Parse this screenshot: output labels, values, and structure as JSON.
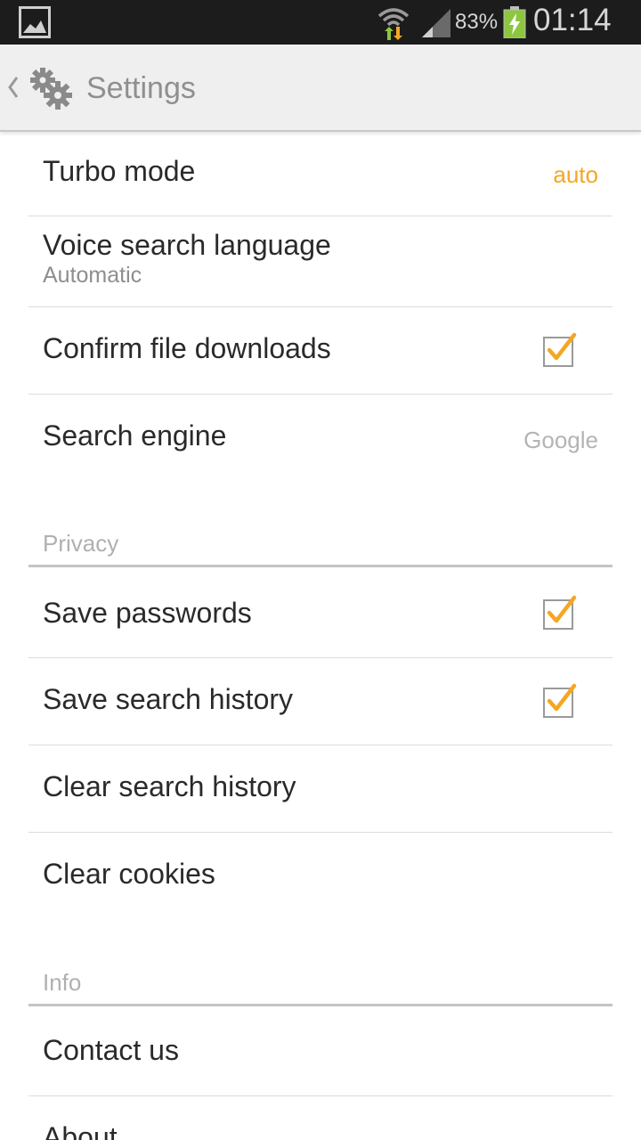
{
  "status_bar": {
    "battery_percent": "83%",
    "time": "01:14",
    "icons": [
      "gallery-notification-icon",
      "wifi-icon",
      "signal-icon",
      "battery-charging-icon"
    ]
  },
  "action_bar": {
    "title": "Settings",
    "icons": [
      "back-chevron-icon",
      "gears-icon"
    ]
  },
  "colors": {
    "accent": "#f5a623",
    "status_bar_bg": "#1c1c1c",
    "action_bar_bg": "#efefef",
    "text_primary": "#2a2a2a",
    "text_secondary": "#8e8e8e"
  },
  "settings": {
    "turbo_mode": {
      "label": "Turbo mode",
      "value": "auto"
    },
    "voice_search_language": {
      "label": "Voice search language",
      "sub": "Automatic"
    },
    "confirm_file_downloads": {
      "label": "Confirm file downloads",
      "checked": true
    },
    "search_engine": {
      "label": "Search engine",
      "value": "Google"
    }
  },
  "privacy": {
    "header": "Privacy",
    "save_passwords": {
      "label": "Save passwords",
      "checked": true
    },
    "save_search_history": {
      "label": "Save search history",
      "checked": true
    },
    "clear_search_history": {
      "label": "Clear search history"
    },
    "clear_cookies": {
      "label": "Clear cookies"
    }
  },
  "info": {
    "header": "Info",
    "contact_us": {
      "label": "Contact us"
    },
    "about": {
      "label": "About"
    }
  }
}
